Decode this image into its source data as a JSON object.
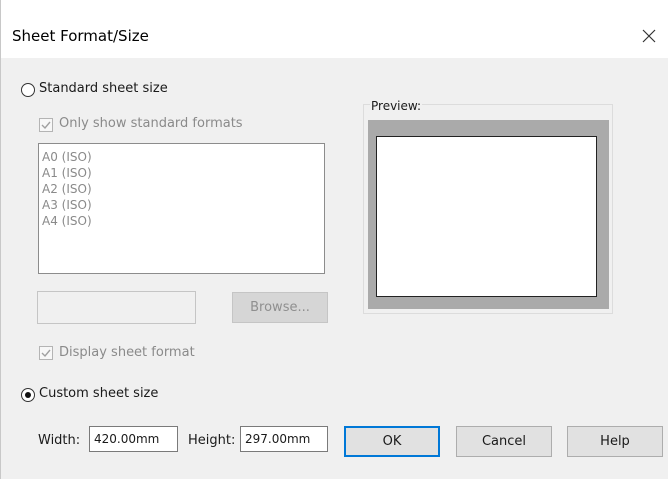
{
  "dialog": {
    "title": "Sheet Format/Size",
    "close_icon": "close-icon"
  },
  "standard": {
    "radio_label": "Standard sheet size",
    "selected": false,
    "only_standard_label": "Only show standard formats",
    "only_standard_checked": true,
    "formats": [
      "A0 (ISO)",
      "A1 (ISO)",
      "A2 (ISO)",
      "A3 (ISO)",
      "A4 (ISO)"
    ],
    "file_value": "",
    "browse_label": "Browse...",
    "display_format_label": "Display sheet format",
    "display_format_checked": true
  },
  "preview": {
    "label": "Preview:"
  },
  "custom": {
    "radio_label": "Custom sheet size",
    "selected": true,
    "width_label": "Width:",
    "width_value": "420.00mm",
    "height_label": "Height:",
    "height_value": "297.00mm"
  },
  "buttons": {
    "ok": "OK",
    "cancel": "Cancel",
    "help": "Help"
  },
  "colors": {
    "accent": "#0078d7",
    "background": "#f0f0f0"
  }
}
